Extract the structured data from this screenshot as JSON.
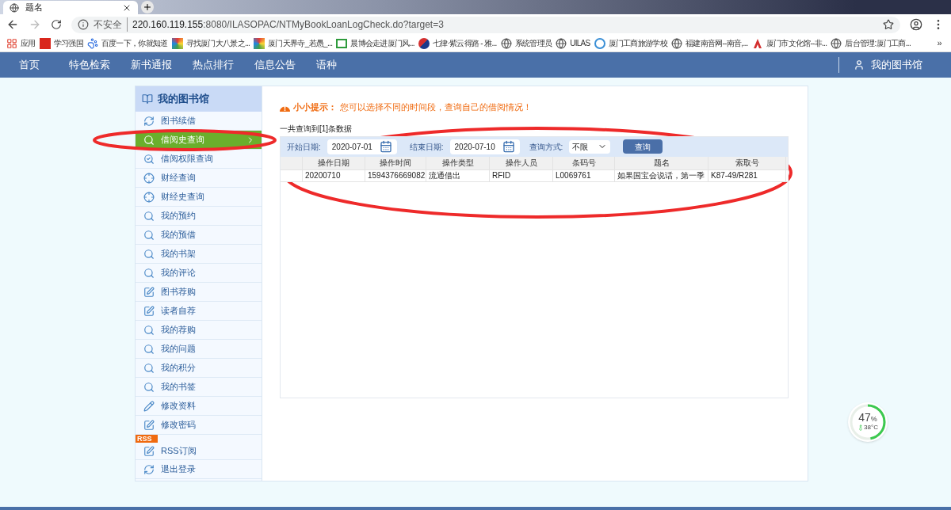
{
  "browser": {
    "tab_title": "题名",
    "security": "不安全",
    "url_host": "220.160.119.155",
    "url_rest": ":8080/ILASOPAC/NTMyBookLoanLogCheck.do?target=3",
    "bookmarks": [
      {
        "label": "应用",
        "kind": "apps"
      },
      {
        "label": "学习强国",
        "kind": "red"
      },
      {
        "label": "百度一下，你就知道",
        "kind": "paw"
      },
      {
        "label": "寻找厦门大八景之...",
        "kind": "multi"
      },
      {
        "label": "厦门天界寺_若愚_...",
        "kind": "multi"
      },
      {
        "label": "晨博会走进厦门风...",
        "kind": "green"
      },
      {
        "label": "七律·紫云得路 - 雅...",
        "kind": "circle"
      },
      {
        "label": "系统管理员",
        "kind": "globe"
      },
      {
        "label": "UILAS",
        "kind": "globe"
      },
      {
        "label": "厦门工商旅游学校",
        "kind": "school"
      },
      {
        "label": "福建南音网--南音,...",
        "kind": "globe"
      },
      {
        "label": "厦门市文化馆--非...",
        "kind": "redmark"
      },
      {
        "label": "后台管理:厦门工商...",
        "kind": "globe"
      }
    ],
    "overflow": "»"
  },
  "nav": {
    "items": [
      "首页",
      "特色检索",
      "新书通报",
      "热点排行",
      "信息公告",
      "语种"
    ],
    "account": "我的图书馆"
  },
  "sidebar": {
    "title": "我的图书馆",
    "items": [
      {
        "label": "图书续借",
        "kind": "refresh",
        "selected": false
      },
      {
        "label": "借阅史查询",
        "kind": "search",
        "selected": true
      },
      {
        "label": "借阅权限查询",
        "kind": "check",
        "selected": false
      },
      {
        "label": "财经查询",
        "kind": "target",
        "selected": false
      },
      {
        "label": "财经史查询",
        "kind": "target",
        "selected": false
      },
      {
        "label": "我的预约",
        "kind": "search",
        "selected": false
      },
      {
        "label": "我的预借",
        "kind": "search",
        "selected": false
      },
      {
        "label": "我的书架",
        "kind": "search",
        "selected": false
      },
      {
        "label": "我的评论",
        "kind": "search",
        "selected": false
      },
      {
        "label": "图书荐购",
        "kind": "edit",
        "selected": false
      },
      {
        "label": "读者自荐",
        "kind": "edit",
        "selected": false
      },
      {
        "label": "我的荐购",
        "kind": "search",
        "selected": false
      },
      {
        "label": "我的问题",
        "kind": "search",
        "selected": false
      },
      {
        "label": "我的积分",
        "kind": "search",
        "selected": false
      },
      {
        "label": "我的书签",
        "kind": "search",
        "selected": false
      },
      {
        "label": "修改资料",
        "kind": "pencil",
        "selected": false
      },
      {
        "label": "修改密码",
        "kind": "edit",
        "selected": false
      },
      {
        "label": "RSS订阅",
        "kind": "edit",
        "selected": false,
        "badge": "RSS"
      },
      {
        "label": "退出登录",
        "kind": "refresh",
        "selected": false
      }
    ]
  },
  "tip": {
    "label": "小小提示：",
    "text": "您可以选择不同的时间段，查询自己的借阅情况！"
  },
  "result_count": "一共查询到[1]条数据",
  "filters": {
    "start_label": "开始日期:",
    "start_value": "2020-07-01",
    "end_label": "结束日期:",
    "end_value": "2020-07-10",
    "mode_label": "查询方式:",
    "mode_value": "不限",
    "button": "查询"
  },
  "table": {
    "columns": [
      "操作日期",
      "操作时间",
      "操作类型",
      "操作人员",
      "条码号",
      "题名",
      "索取号"
    ],
    "rows": [
      [
        "20200710",
        "1594376669082",
        "流通借出",
        "RFID",
        "L0069761",
        "如果国宝会说话，第一季",
        "K87-49/R281"
      ]
    ]
  },
  "gauge": {
    "percent": "47",
    "unit": "%",
    "temperature": "38°C",
    "level": 0.47
  }
}
